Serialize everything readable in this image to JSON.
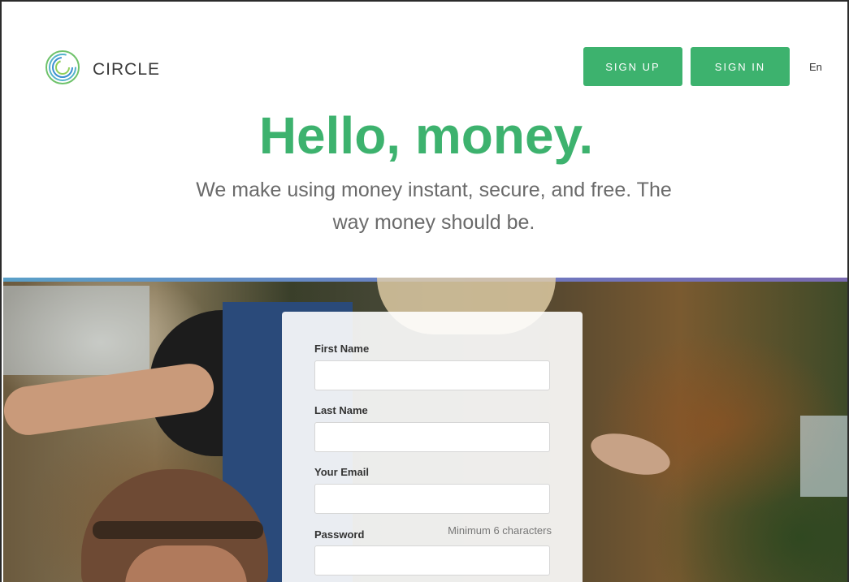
{
  "header": {
    "brand": "CIRCLE",
    "signup_label": "SIGN UP",
    "signin_label": "SIGN IN",
    "language": "En"
  },
  "hero": {
    "title": "Hello, money.",
    "subtitle": "We make using money instant, secure, and free. The way money should be."
  },
  "form": {
    "first_name_label": "First Name",
    "first_name_value": "",
    "last_name_label": "Last Name",
    "last_name_value": "",
    "email_label": "Your Email",
    "email_value": "",
    "password_label": "Password",
    "password_value": "",
    "password_hint": "Minimum 6 characters"
  },
  "colors": {
    "brand_green": "#3db26e",
    "text_dark": "#333333",
    "text_muted": "#6a6a6a"
  },
  "icons": {
    "logo": "circle-logo-icon"
  }
}
